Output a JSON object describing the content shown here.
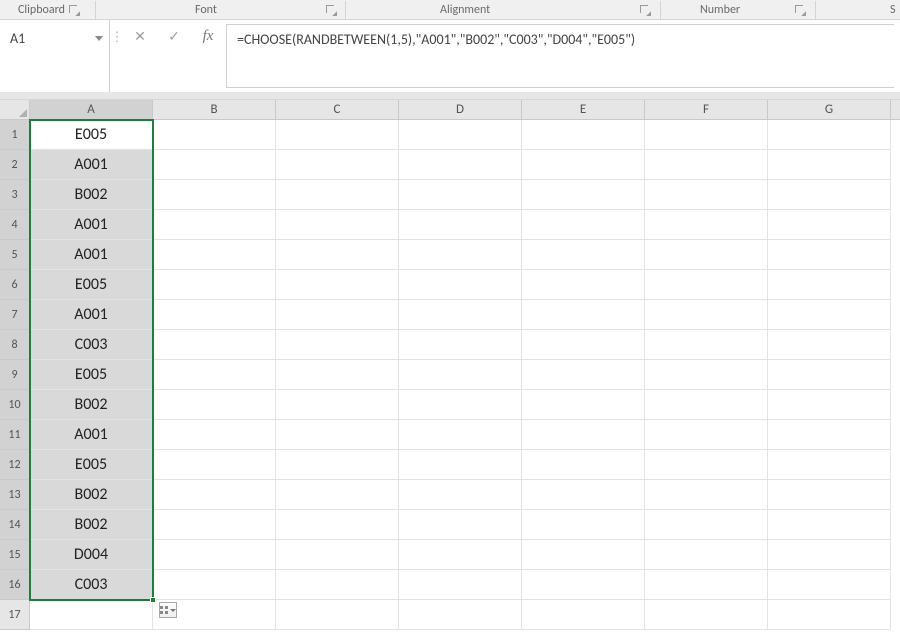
{
  "ribbon": {
    "groups": [
      "Clipboard",
      "Font",
      "Alignment",
      "Number",
      "S"
    ]
  },
  "nameBox": {
    "value": "A1"
  },
  "formulaBar": {
    "value": "=CHOOSE(RANDBETWEEN(1,5),\"A001\",\"B002\",\"C003\",\"D004\",\"E005\")"
  },
  "columns": [
    "A",
    "B",
    "C",
    "D",
    "E",
    "F",
    "G"
  ],
  "rowCount": 17,
  "selection": {
    "col": "A",
    "startRow": 1,
    "endRow": 16,
    "activeRow": 1
  },
  "cells": {
    "A": [
      "E005",
      "A001",
      "B002",
      "A001",
      "A001",
      "E005",
      "A001",
      "C003",
      "E005",
      "B002",
      "A001",
      "E005",
      "B002",
      "B002",
      "D004",
      "C003",
      "",
      "",
      ""
    ]
  }
}
